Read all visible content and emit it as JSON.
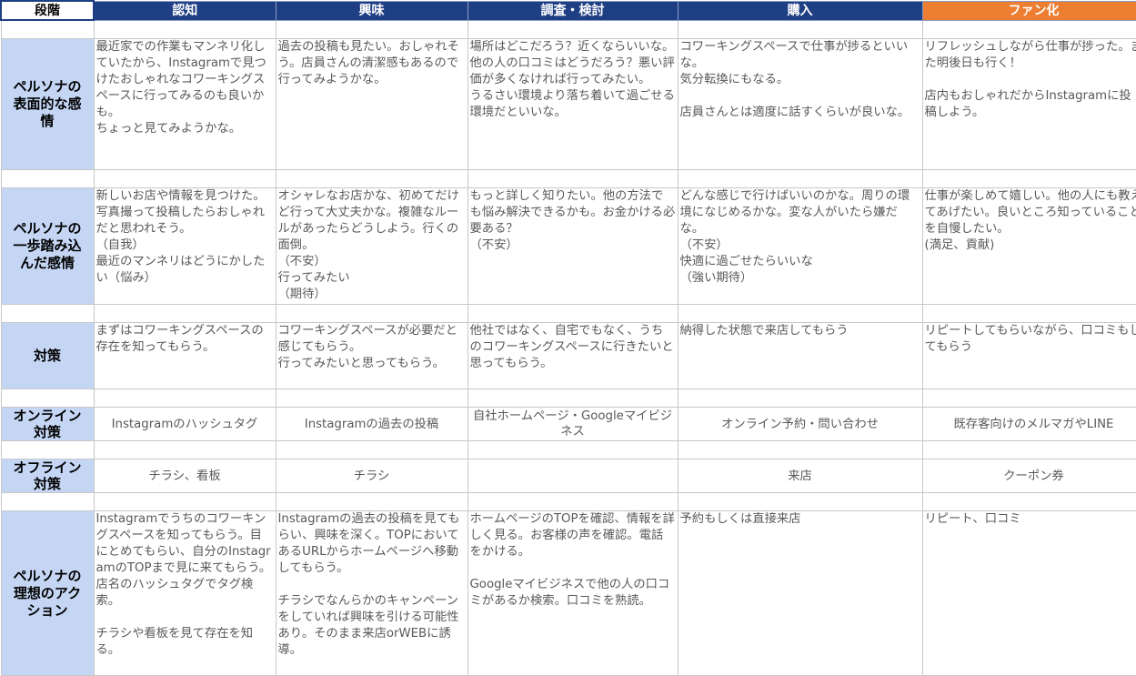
{
  "header": {
    "corner": "段階",
    "stages": [
      "認知",
      "興味",
      "調査・検討",
      "購入",
      "ファン化"
    ]
  },
  "rows": [
    {
      "label": "ペルソナの\n表面的な感\n情",
      "cells": [
        "最近家での作業もマンネリ化していたから、Instagramで見つけたおしゃれなコワーキングスペースに行ってみるのも良いかも。\nちょっと見てみようかな。",
        "過去の投稿も見たい。おしゃれそう。店員さんの清潔感もあるので行ってみようかな。",
        "場所はどこだろう？近くならいいな。\n他の人の口コミはどうだろう？悪い評価が多くなければ行ってみたい。\nうるさい環境より落ち着いて過ごせる環境だといいな。",
        "コワーキングスペースで仕事が捗るといいな。\n気分転換にもなる。\n\n店員さんとは適度に話すくらいが良いな。",
        "リフレッシュしながら仕事が捗った。また明後日も行く！\n\n店内もおしゃれだからInstagramに投稿しよう。"
      ]
    },
    {
      "label": "ペルソナの\n一歩踏み込\nんだ感情",
      "cells": [
        "新しいお店や情報を見つけた。写真撮って投稿したらおしゃれだと思われそう。\n（自我）\n最近のマンネリはどうにかしたい（悩み）",
        "オシャレなお店かな、初めてだけど行って大丈夫かな。複雑なルールがあったらどうしよう。行くの面倒。\n（不安）\n行ってみたい\n（期待）",
        "もっと詳しく知りたい。他の方法でも悩み解決できるかも。お金かける必要ある？\n（不安）",
        "どんな感じで行けばいいのかな。周りの環境になじめるかな。変な人がいたら嫌だな。\n（不安）\n快適に過ごせたらいいな\n（強い期待）",
        "仕事が楽しめて嬉しい。他の人にも教えてあげたい。良いところ知っていることを自慢したい。\n(満足、貢献)"
      ]
    },
    {
      "label": "対策",
      "cells": [
        "まずはコワーキングスペースの存在を知ってもらう。",
        "コワーキングスペースが必要だと感じてもらう。\n行ってみたいと思ってもらう。",
        "他社ではなく、自宅でもなく、うちのコワーキングスペースに行きたいと思ってもらう。",
        "納得した状態で来店してもらう",
        "リピートしてもらいながら、口コミもしてもらう"
      ]
    },
    {
      "label": "オンライン\n対策",
      "cells": [
        "Instagramのハッシュタグ",
        "Instagramの過去の投稿",
        "自社ホームページ・Googleマイビジネス",
        "オンライン予約・問い合わせ",
        "既存客向けのメルマガやLINE"
      ]
    },
    {
      "label": "オフライン\n対策",
      "cells": [
        "チラシ、看板",
        "チラシ",
        "",
        "来店",
        "クーポン券"
      ]
    },
    {
      "label": "ペルソナの\n理想のアク\nション",
      "cells": [
        "Instagramでうちのコワーキングスペースを知ってもらう。目にとめてもらい、自分のInstagramのTOPまで見に来てもらう。\n店名のハッシュタグでタグ検索。\n\nチラシや看板を見て存在を知る。",
        "Instagramの過去の投稿を見てもらい、興味を深く。TOPにおいてあるURLからホームページへ移動してもらう。\n\nチラシでなんらかのキャンペーンをしていれば興味を引ける可能性あり。そのまま来店orWEBに誘導。",
        "ホームページのTOPを確認、情報を詳しく見る。お客様の声を確認。電話をかける。\n\nGoogleマイビジネスで他の人の口コミがあるか検索。口コミを熟読。",
        "予約もしくは直接来店",
        "リピート、口コミ"
      ]
    }
  ]
}
